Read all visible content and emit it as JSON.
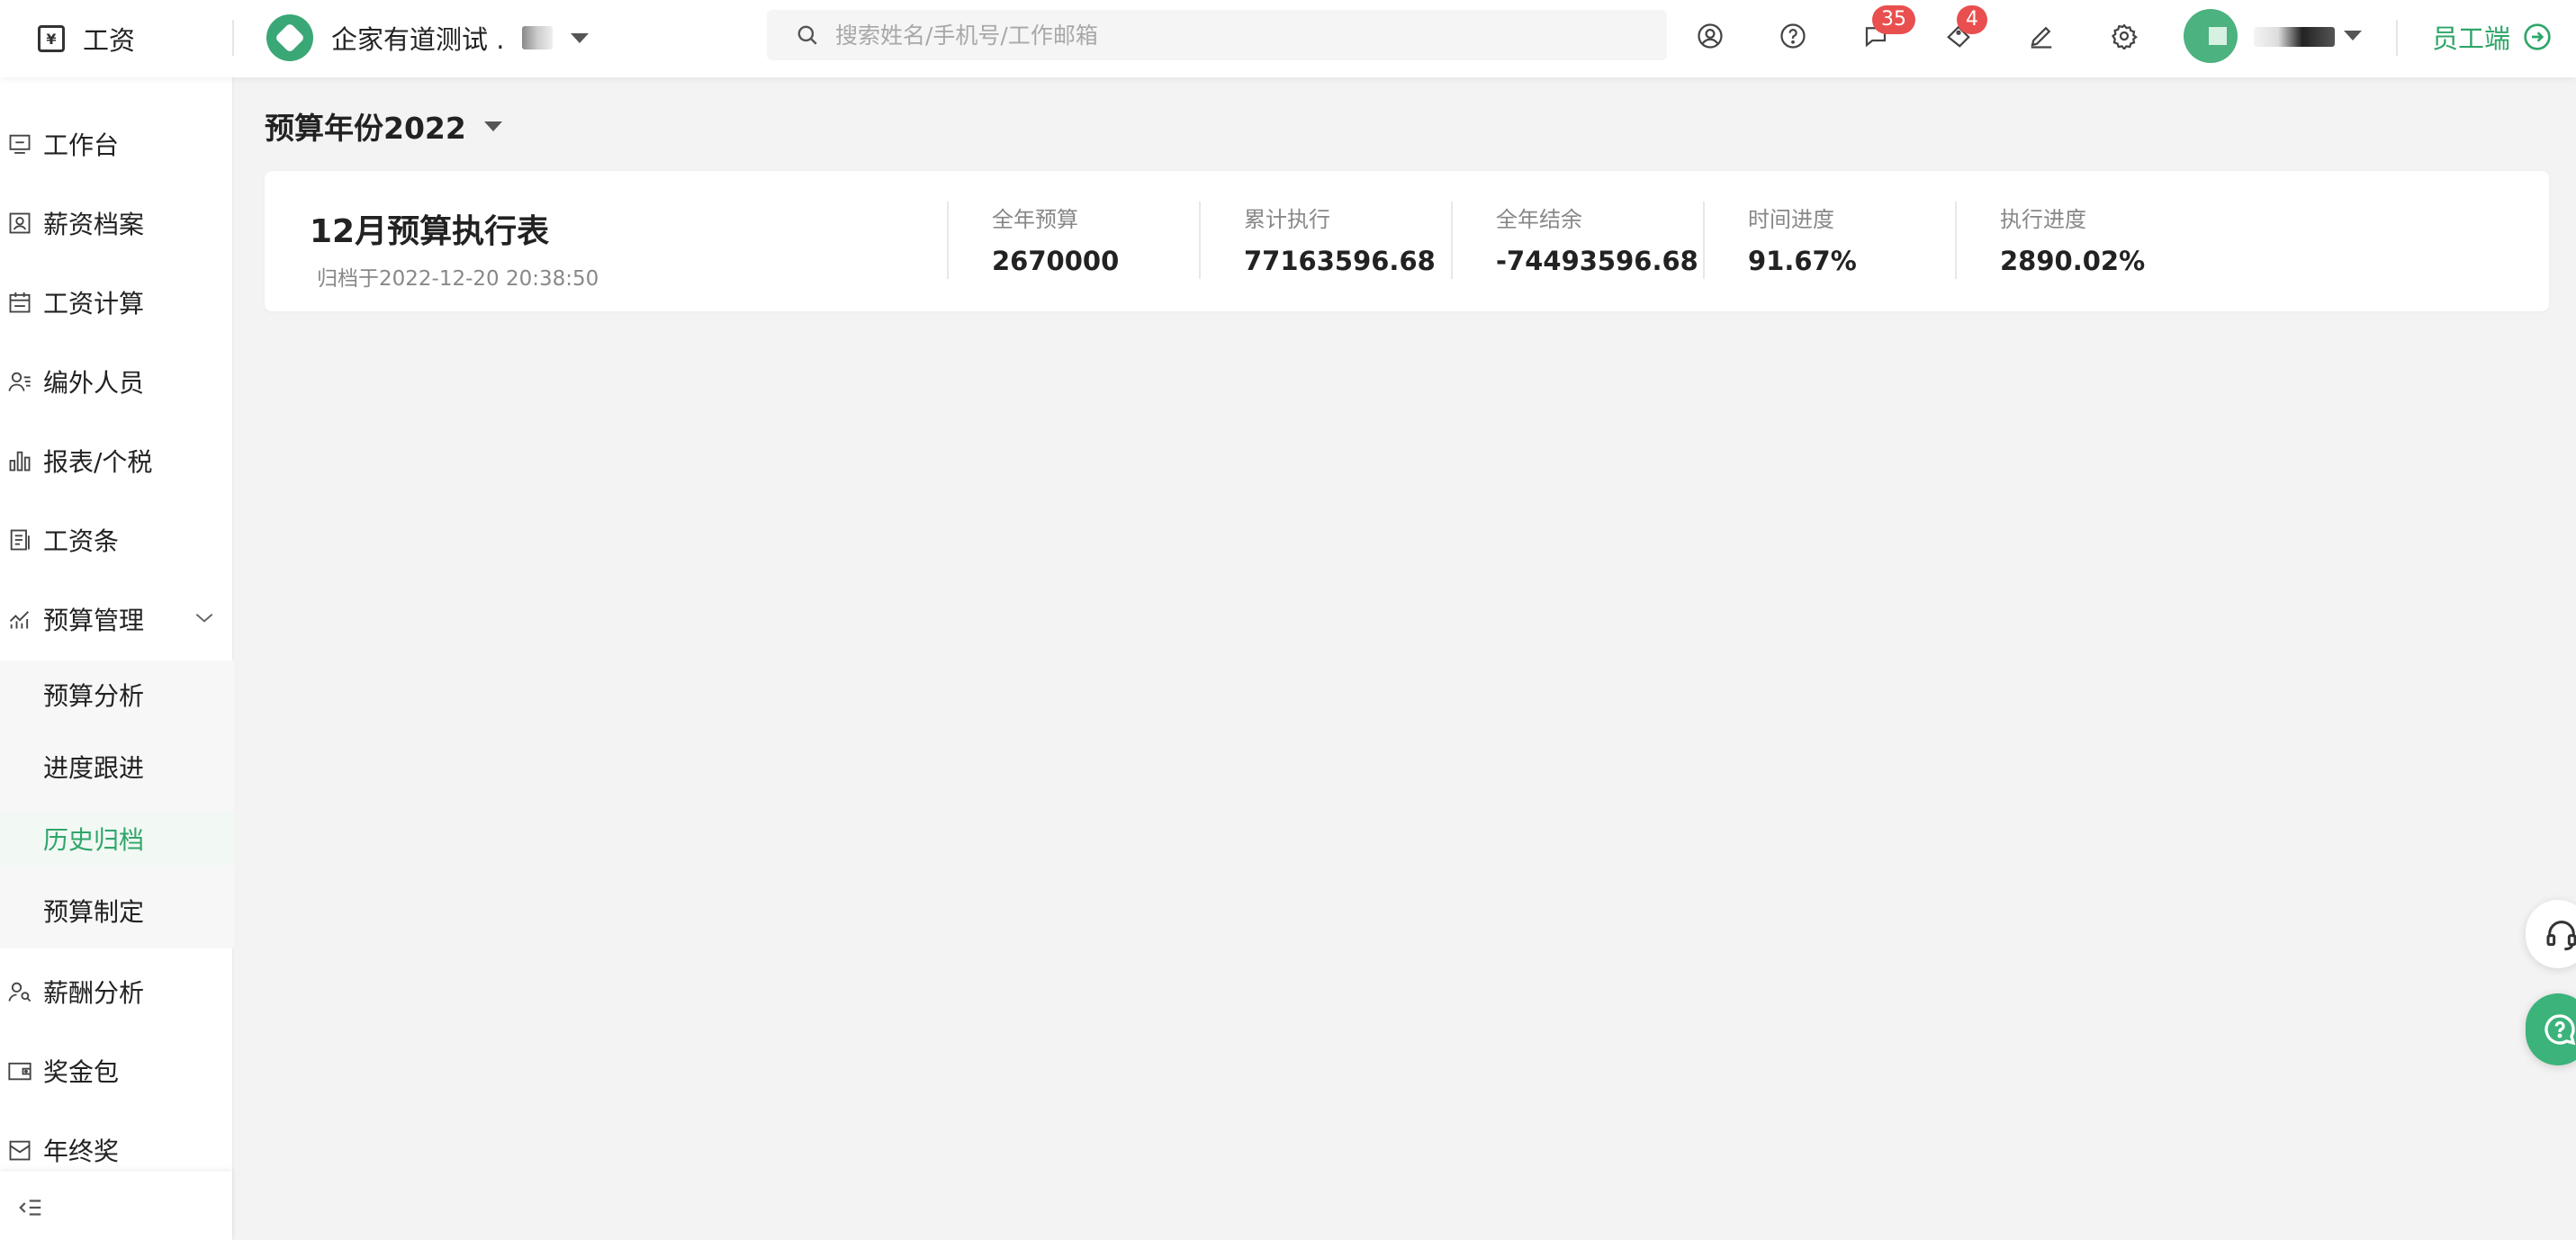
{
  "app": {
    "icon_glyph": "¥",
    "title": "工资"
  },
  "org": {
    "name": "企家有道测试 ."
  },
  "search": {
    "placeholder": "搜索姓名/手机号/工作邮箱"
  },
  "toolbar": {
    "icons": [
      "user-circle-icon",
      "help-icon",
      "message-icon",
      "ticket-icon",
      "edit-icon",
      "gear-icon"
    ],
    "message_badge": "35",
    "ticket_badge": "4"
  },
  "employee_portal": {
    "label": "员工端"
  },
  "sidebar": {
    "items": [
      {
        "label": "工作台",
        "icon": "workbench-icon"
      },
      {
        "label": "薪资档案",
        "icon": "profile-icon"
      },
      {
        "label": "工资计算",
        "icon": "calendar-icon"
      },
      {
        "label": "编外人员",
        "icon": "person-list-icon"
      },
      {
        "label": "报表/个税",
        "icon": "bar-chart-icon"
      },
      {
        "label": "工资条",
        "icon": "document-icon"
      },
      {
        "label": "预算管理",
        "icon": "trend-chart-icon"
      },
      {
        "label": "薪酬分析",
        "icon": "person-search-icon"
      },
      {
        "label": "奖金包",
        "icon": "wallet-icon"
      },
      {
        "label": "年终奖",
        "icon": "gift-box-icon"
      }
    ],
    "sub_items": [
      {
        "label": "预算分析"
      },
      {
        "label": "进度跟进"
      },
      {
        "label": "历史归档"
      },
      {
        "label": "预算制定"
      }
    ],
    "active_sub": "历史归档"
  },
  "main": {
    "year_select": {
      "label": "预算年份2022"
    },
    "card": {
      "title": "12月预算执行表",
      "archived": "归档于2022-12-20 20:38:50",
      "stats": [
        {
          "label": "全年预算",
          "value": "2670000"
        },
        {
          "label": "累计执行",
          "value": "77163596.68"
        },
        {
          "label": "全年结余",
          "value": "-74493596.68"
        },
        {
          "label": "时间进度",
          "value": "91.67%"
        },
        {
          "label": "执行进度",
          "value": "2890.02%"
        }
      ]
    }
  },
  "colors": {
    "accent": "#2fa66a",
    "badge": "#e94f4f",
    "background": "#f3f3f3"
  }
}
